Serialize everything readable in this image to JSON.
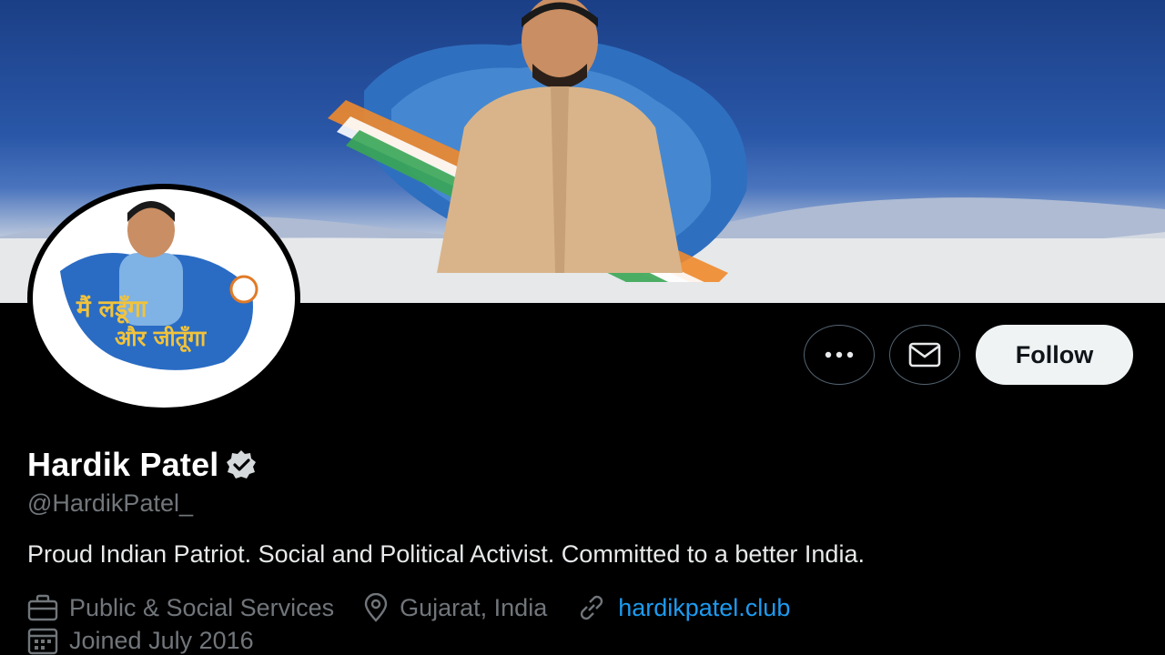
{
  "profile": {
    "display_name": "Hardik Patel",
    "handle": "@HardikPatel_",
    "bio": "Proud Indian Patriot. Social and Political Activist. Committed to a better India.",
    "category": "Public & Social Services",
    "location": "Gujarat, India",
    "website": "hardikpatel.club",
    "joined": "Joined July 2016"
  },
  "avatar": {
    "text_line1": "मैं लडूँगा",
    "text_line2": "और जीतूँगा"
  },
  "actions": {
    "follow_label": "Follow"
  },
  "icons": {
    "more": "more-icon",
    "message": "envelope-icon",
    "verified": "verified-badge-icon",
    "category": "briefcase-icon",
    "location": "location-pin-icon",
    "website": "link-icon",
    "joined": "calendar-icon"
  },
  "colors": {
    "background": "#000000",
    "link": "#1d9bf0",
    "secondary_text": "#71767b",
    "follow_bg": "#eff3f4"
  }
}
